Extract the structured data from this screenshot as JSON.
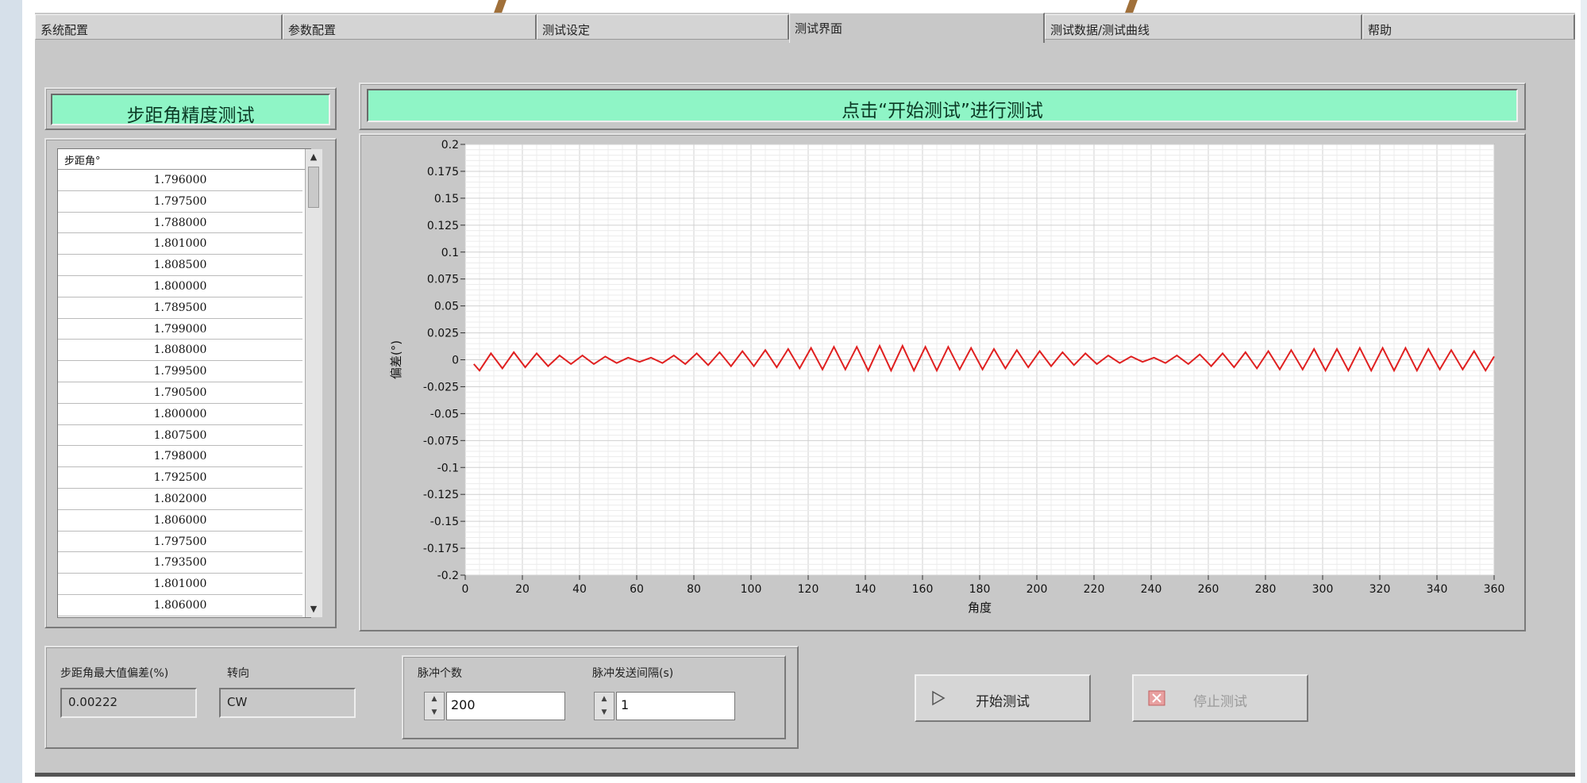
{
  "tabs": [
    {
      "label": "系统配置"
    },
    {
      "label": "参数配置"
    },
    {
      "label": "测试设定"
    },
    {
      "label": "测试界面"
    },
    {
      "label": "测试数据/测试曲线"
    },
    {
      "label": "帮助"
    }
  ],
  "left_title": "步距角精度测试",
  "chart_title": "点击“开始测试”进行测试",
  "list": {
    "header": "步距角°",
    "rows": [
      "1.796000",
      "1.797500",
      "1.788000",
      "1.801000",
      "1.808500",
      "1.800000",
      "1.789500",
      "1.799000",
      "1.808000",
      "1.799500",
      "1.790500",
      "1.800000",
      "1.807500",
      "1.798000",
      "1.792500",
      "1.802000",
      "1.806000",
      "1.797500",
      "1.793500",
      "1.801000",
      "1.806000"
    ],
    "scroll_up_icon": "triangle-up-icon",
    "scroll_down_icon": "triangle-down-icon"
  },
  "chart_data": {
    "type": "line",
    "xlabel": "角度",
    "ylabel": "偏差(°)",
    "xlim": [
      0,
      360
    ],
    "ylim": [
      -0.2,
      0.2
    ],
    "x_ticks": [
      0,
      20,
      40,
      60,
      80,
      100,
      120,
      140,
      160,
      180,
      200,
      220,
      240,
      260,
      280,
      300,
      320,
      340,
      360
    ],
    "y_ticks": [
      0.2,
      0.175,
      0.15,
      0.125,
      0.1,
      0.075,
      0.05,
      0.025,
      0,
      -0.025,
      -0.05,
      -0.075,
      -0.1,
      -0.125,
      -0.15,
      -0.175,
      -0.2
    ],
    "grid": true,
    "line_color": "#e02020",
    "series": [
      {
        "x": [
          3,
          5,
          9,
          13,
          17,
          21,
          25,
          29,
          33,
          37,
          41,
          45,
          49,
          53,
          57,
          61,
          65,
          69,
          73,
          77,
          81,
          85,
          89,
          93,
          97,
          101,
          105,
          109,
          113,
          117,
          121,
          125,
          129,
          133,
          137,
          141,
          145,
          149,
          153,
          157,
          161,
          165,
          169,
          173,
          177,
          181,
          185,
          189,
          193,
          197,
          201,
          205,
          209,
          213,
          217,
          221,
          225,
          229,
          233,
          237,
          241,
          245,
          249,
          253,
          257,
          261,
          265,
          269,
          273,
          277,
          281,
          285,
          289,
          293,
          297,
          301,
          305,
          309,
          313,
          317,
          321,
          325,
          329,
          333,
          337,
          341,
          345,
          349,
          353,
          357,
          360
        ],
        "y": [
          -0.004,
          -0.01,
          0.006,
          -0.008,
          0.007,
          -0.007,
          0.006,
          -0.006,
          0.004,
          -0.004,
          0.004,
          -0.004,
          0.003,
          -0.003,
          0.002,
          -0.002,
          0.002,
          -0.003,
          0.004,
          -0.004,
          0.006,
          -0.005,
          0.007,
          -0.006,
          0.008,
          -0.006,
          0.009,
          -0.007,
          0.01,
          -0.008,
          0.011,
          -0.009,
          0.012,
          -0.009,
          0.012,
          -0.01,
          0.013,
          -0.01,
          0.013,
          -0.01,
          0.012,
          -0.01,
          0.012,
          -0.009,
          0.011,
          -0.009,
          0.01,
          -0.008,
          0.009,
          -0.007,
          0.008,
          -0.006,
          0.007,
          -0.005,
          0.006,
          -0.004,
          0.004,
          -0.003,
          0.003,
          -0.002,
          0.002,
          -0.003,
          0.004,
          -0.004,
          0.005,
          -0.006,
          0.006,
          -0.007,
          0.007,
          -0.008,
          0.008,
          -0.009,
          0.009,
          -0.009,
          0.01,
          -0.01,
          0.01,
          -0.01,
          0.011,
          -0.01,
          0.011,
          -0.01,
          0.011,
          -0.01,
          0.01,
          -0.009,
          0.009,
          -0.009,
          0.008,
          -0.01,
          0.003
        ]
      }
    ]
  },
  "controls": {
    "max_dev_label": "步距角最大值偏差(%)",
    "direction_label": "转向",
    "max_dev_value": "0.00222",
    "direction_value": "CW",
    "pulse_count_label": "脉冲个数",
    "pulse_count_value": "200",
    "pulse_interval_label": "脉冲发送间隔(s)",
    "pulse_interval_value": "1",
    "start_label": "开始测试",
    "start_icon": "play-outline-icon",
    "stop_label": "停止测试",
    "stop_icon": "stop-x-icon"
  },
  "colors": {
    "accent_green": "#8ff5c6",
    "plot_line": "#e02020",
    "stop_icon": "#e08080"
  }
}
